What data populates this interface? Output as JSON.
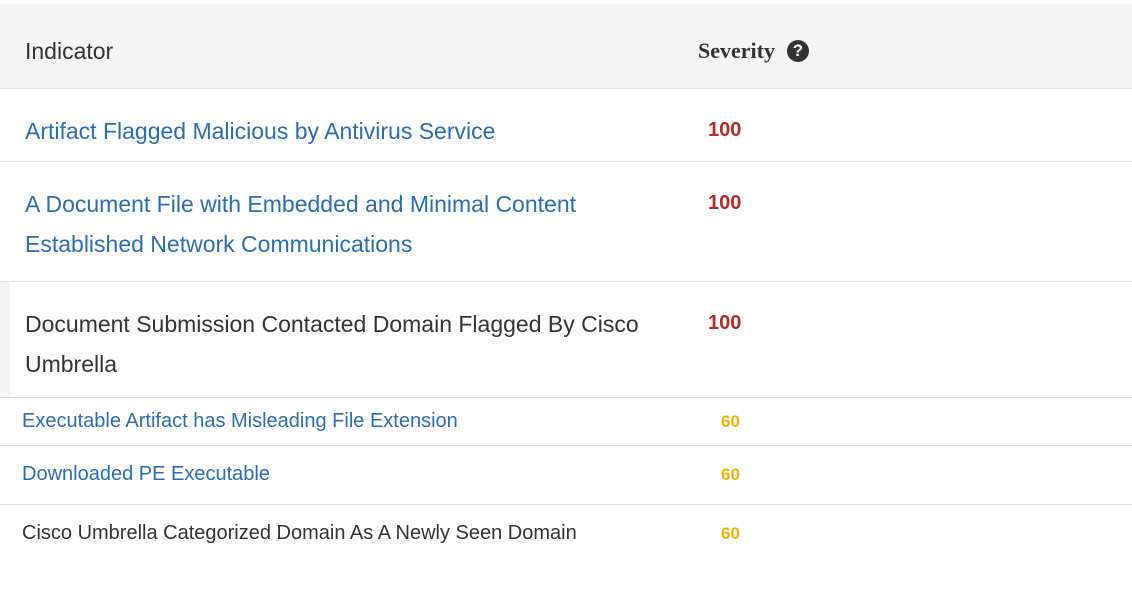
{
  "header": {
    "indicator_label": "Indicator",
    "severity_label": "Severity",
    "help_icon": "question-circle-icon",
    "help_glyph": "?"
  },
  "rows": [
    {
      "indicator": "Artifact Flagged Malicious by Antivirus Service",
      "severity": "100",
      "link": true
    },
    {
      "indicator": "A Document File with Embedded and Minimal Content Established Network Communications",
      "severity": "100",
      "link": true
    },
    {
      "indicator": "Document Submission Contacted Domain Flagged By Cisco Umbrella",
      "severity": "100",
      "link": false
    },
    {
      "indicator": "Executable Artifact has Misleading File Extension",
      "severity": "60",
      "link": true
    },
    {
      "indicator": "Downloaded PE Executable",
      "severity": "60",
      "link": true
    },
    {
      "indicator": "Cisco Umbrella Categorized Domain As A Newly Seen Domain",
      "severity": "60",
      "link": false
    }
  ],
  "colors": {
    "link": "#2a6db3",
    "severity_high": "#b52b2b",
    "severity_medium": "#f0b400",
    "header_bg": "#f5f5f5"
  }
}
